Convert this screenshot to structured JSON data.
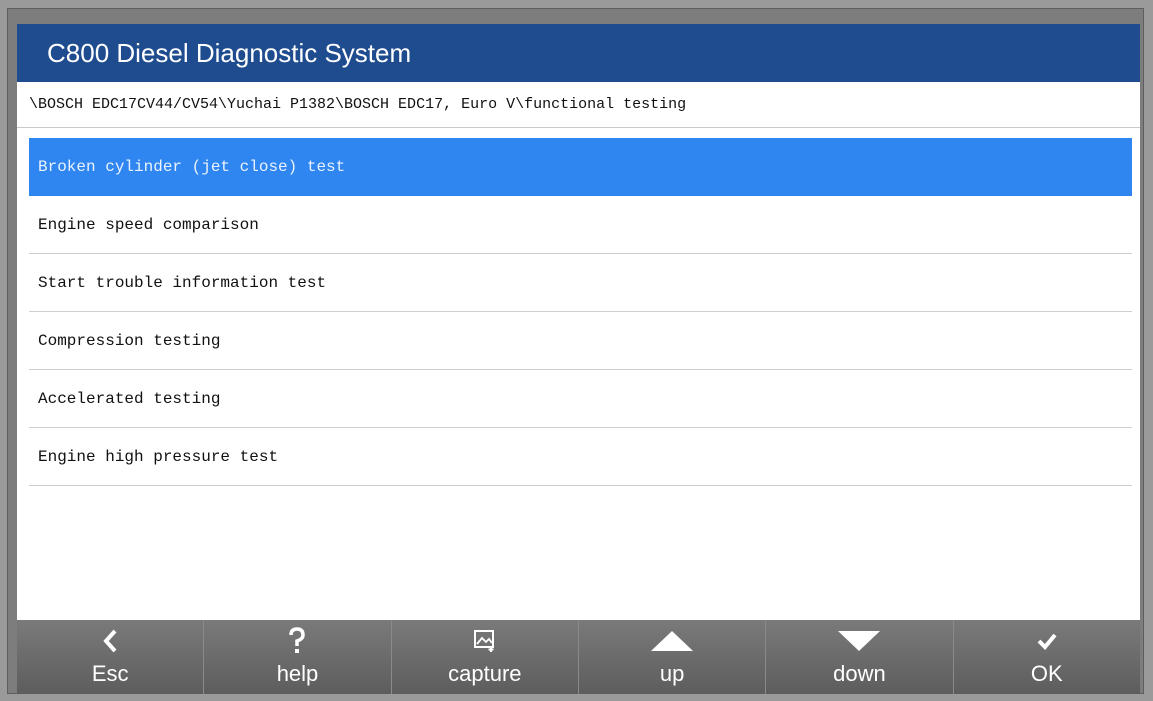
{
  "app": {
    "title": "C800 Diesel Diagnostic System"
  },
  "breadcrumb": "\\BOSCH EDC17CV44/CV54\\Yuchai P1382\\BOSCH EDC17, Euro V\\functional testing",
  "menu": {
    "selected_index": 0,
    "items": [
      "Broken cylinder (jet close) test",
      "Engine speed comparison",
      "Start trouble information test",
      "Compression testing",
      "Accelerated testing",
      "Engine high pressure test"
    ]
  },
  "toolbar": {
    "buttons": [
      {
        "label": "Esc",
        "icon": "chevron-left-icon"
      },
      {
        "label": "help",
        "icon": "question-icon"
      },
      {
        "label": "capture",
        "icon": "capture-icon"
      },
      {
        "label": "up",
        "icon": "triangle-up-icon"
      },
      {
        "label": "down",
        "icon": "triangle-down-icon"
      },
      {
        "label": "OK",
        "icon": "checkmark-icon"
      }
    ]
  },
  "colors": {
    "titlebar": "#1f4c8f",
    "selected_row": "#2f86f0",
    "toolbar": "#6b6b6b"
  }
}
